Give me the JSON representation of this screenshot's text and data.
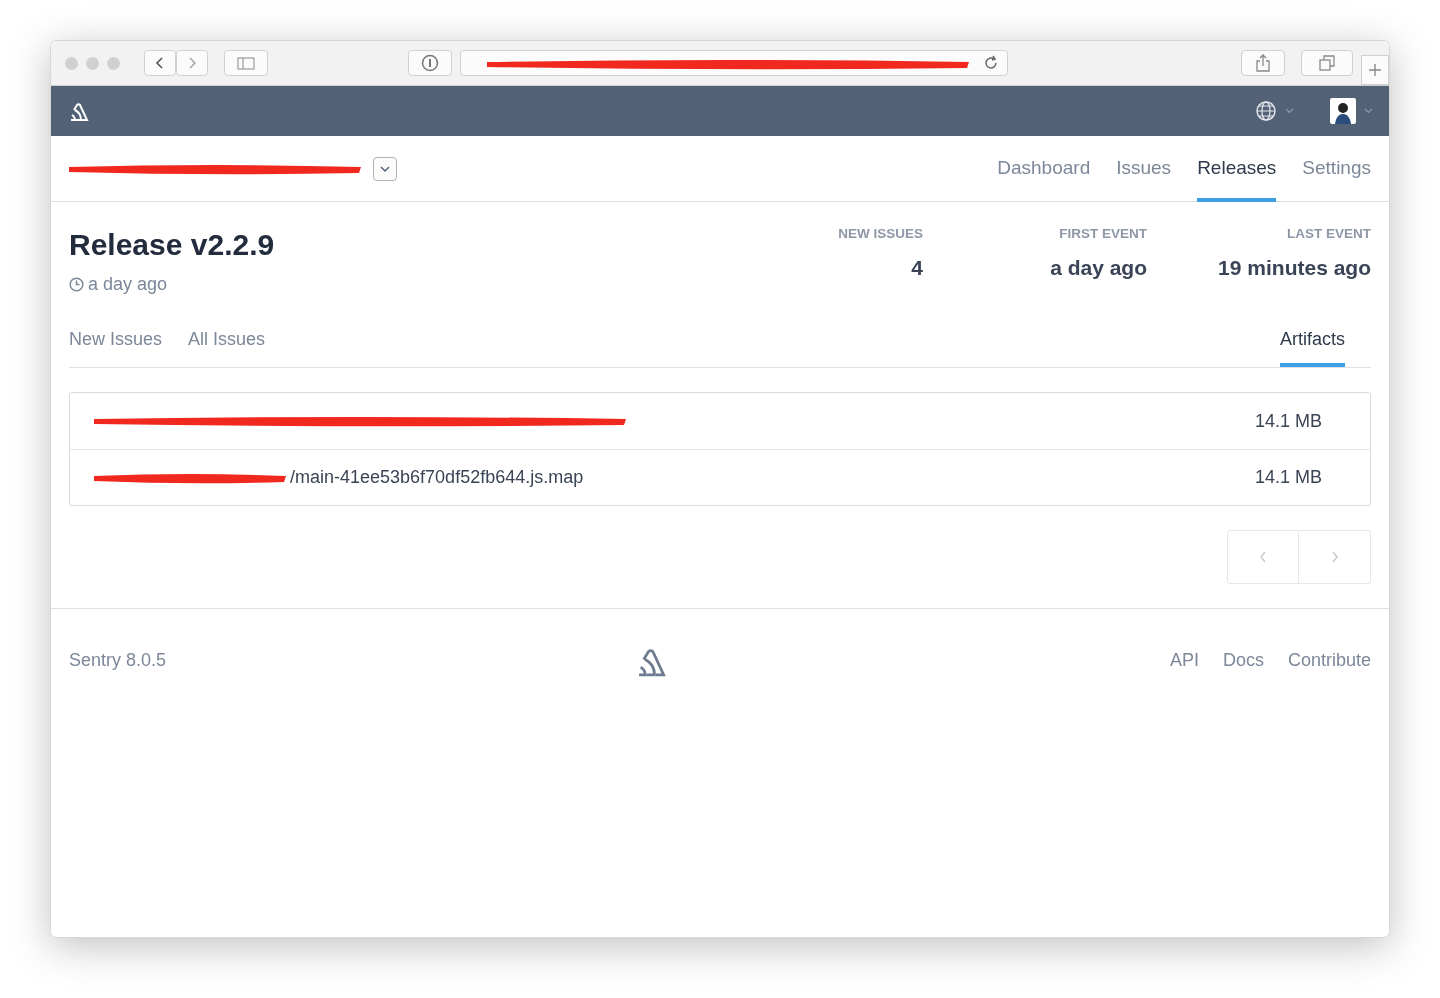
{
  "browser": {
    "address_redacted": true
  },
  "header": {
    "menus": [
      {
        "kind": "globe"
      },
      {
        "kind": "avatar"
      }
    ]
  },
  "project": {
    "name_redacted": true
  },
  "project_nav": [
    {
      "label": "Dashboard",
      "selected": false
    },
    {
      "label": "Issues",
      "selected": false
    },
    {
      "label": "Releases",
      "selected": true
    },
    {
      "label": "Settings",
      "selected": false
    }
  ],
  "release": {
    "title": "Release v2.2.9",
    "age": "a day ago"
  },
  "stats": [
    {
      "label": "NEW ISSUES",
      "value": "4"
    },
    {
      "label": "FIRST EVENT",
      "value": "a day ago"
    },
    {
      "label": "LAST EVENT",
      "value": "19 minutes ago"
    }
  ],
  "release_tabs": {
    "left": [
      {
        "label": "New Issues",
        "selected": false
      },
      {
        "label": "All Issues",
        "selected": false
      }
    ],
    "right": [
      {
        "label": "Artifacts",
        "selected": true
      }
    ]
  },
  "artifacts": [
    {
      "redacted": true,
      "size": "14.1 MB"
    },
    {
      "visible_name": "/main-41ee53b6f70df52fb644.js.map",
      "redacted": true,
      "size": "14.1 MB"
    }
  ],
  "pagination": [
    {
      "kind": "prev",
      "disabled": true
    },
    {
      "kind": "next",
      "disabled": true
    }
  ],
  "footer": {
    "version": "Sentry 8.0.5",
    "links": [
      "API",
      "Docs",
      "Contribute"
    ]
  }
}
